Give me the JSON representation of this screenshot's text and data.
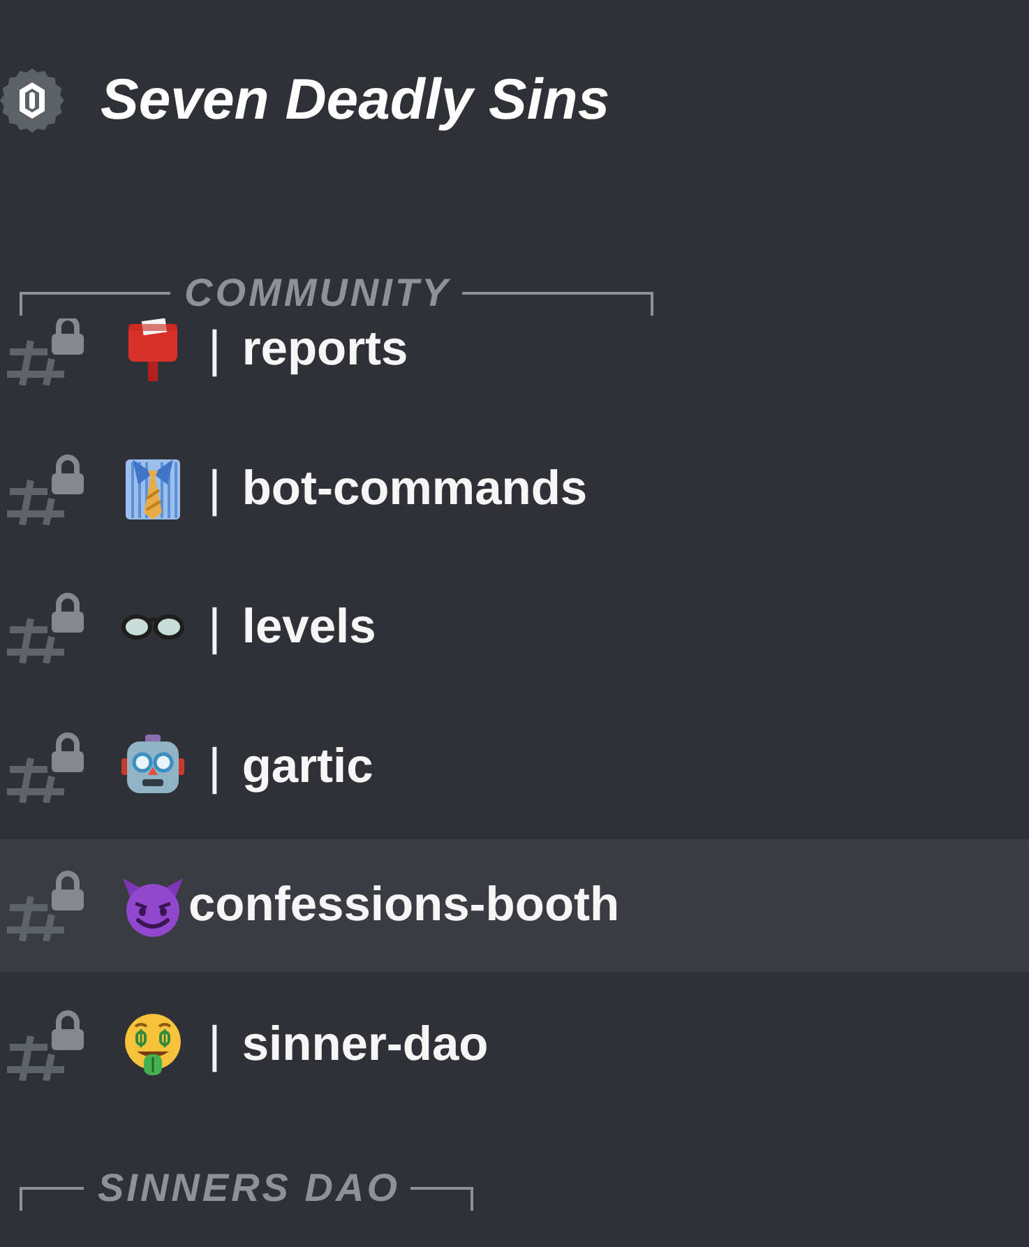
{
  "server": {
    "name": "Seven Deadly Sins"
  },
  "categories": [
    {
      "name": "COMMUNITY",
      "channels": [
        {
          "kind": "postbox",
          "separator": "|",
          "name": "reports",
          "locked": true,
          "selected": false
        },
        {
          "kind": "shirt-tie",
          "separator": "|",
          "name": "bot-commands",
          "locked": true,
          "selected": false
        },
        {
          "kind": "glasses",
          "separator": "|",
          "name": "levels",
          "locked": true,
          "selected": false
        },
        {
          "kind": "robot",
          "separator": "|",
          "name": "gartic",
          "locked": true,
          "selected": false
        },
        {
          "kind": "devil",
          "name": "confessions-booth",
          "locked": true,
          "selected": true
        },
        {
          "kind": "money-face",
          "separator": "|",
          "name": "sinner-dao",
          "locked": true,
          "selected": false
        }
      ]
    },
    {
      "name": "SINNERS DAO"
    }
  ]
}
